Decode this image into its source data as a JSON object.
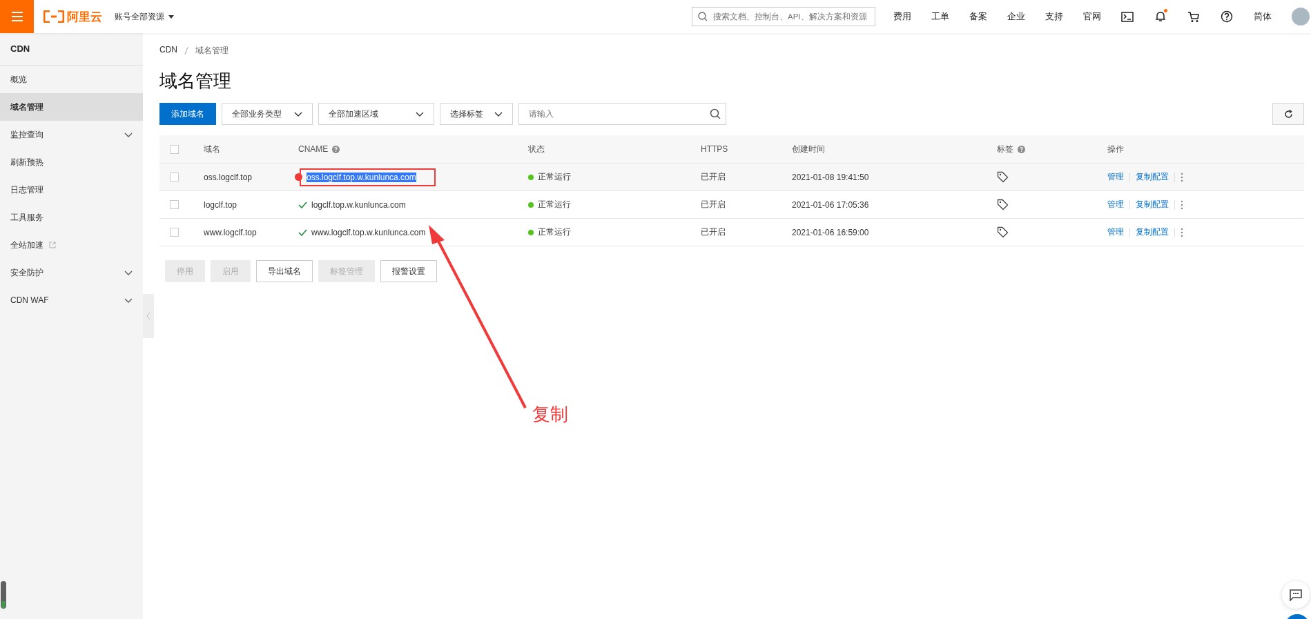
{
  "topbar": {
    "brand": "阿里云",
    "account_menu": "账号全部资源",
    "search": {
      "placeholder": "搜索文档、控制台、API、解决方案和资源"
    },
    "links": [
      "费用",
      "工单",
      "备案",
      "企业",
      "支持",
      "官网"
    ],
    "notification_dot": true,
    "language": "简体"
  },
  "sidebar": {
    "title": "CDN",
    "items": [
      {
        "label": "概览",
        "selected": false,
        "kind": "plain"
      },
      {
        "label": "域名管理",
        "selected": true,
        "kind": "plain"
      },
      {
        "label": "监控查询",
        "selected": false,
        "kind": "expandable"
      },
      {
        "label": "刷新预热",
        "selected": false,
        "kind": "plain"
      },
      {
        "label": "日志管理",
        "selected": false,
        "kind": "plain"
      },
      {
        "label": "工具服务",
        "selected": false,
        "kind": "plain"
      },
      {
        "label": "全站加速",
        "selected": false,
        "kind": "external"
      },
      {
        "label": "安全防护",
        "selected": false,
        "kind": "expandable"
      },
      {
        "label": "CDN WAF",
        "selected": false,
        "kind": "expandable"
      }
    ]
  },
  "breadcrumb": [
    "CDN",
    "域名管理"
  ],
  "page_title": "域名管理",
  "toolbar": {
    "add_button": "添加域名",
    "filters": [
      "全部业务类型",
      "全部加速区域",
      "选择标签"
    ],
    "search": {
      "placeholder": "请输入"
    }
  },
  "table": {
    "select_all_checked": false,
    "columns": [
      {
        "label": "域名",
        "help": false
      },
      {
        "label": "CNAME",
        "help": true
      },
      {
        "label": "状态",
        "help": false
      },
      {
        "label": "HTTPS",
        "help": false
      },
      {
        "label": "创建时间",
        "help": false
      },
      {
        "label": "标签",
        "help": true
      },
      {
        "label": "操作",
        "help": false
      }
    ],
    "rows": [
      {
        "checked": false,
        "hovered": true,
        "domain": "oss.logclf.top",
        "cname": "oss.logclf.top.w.kunlunca.com",
        "cname_ok": false,
        "cname_text_selected": true,
        "annotated": true,
        "status": "正常运行",
        "color": "#52c41a",
        "https": "已开启",
        "created": "2021-01-08 19:41:50",
        "actions": [
          "管理",
          "复制配置"
        ]
      },
      {
        "checked": false,
        "hovered": false,
        "domain": "logclf.top",
        "cname": "logclf.top.w.kunlunca.com",
        "cname_ok": true,
        "cname_text_selected": false,
        "annotated": false,
        "status": "正常运行",
        "color": "#52c41a",
        "https": "已开启",
        "created": "2021-01-06 17:05:36",
        "actions": [
          "管理",
          "复制配置"
        ]
      },
      {
        "checked": false,
        "hovered": false,
        "domain": "www.logclf.top",
        "cname": "www.logclf.top.w.kunlunca.com",
        "cname_ok": true,
        "cname_text_selected": false,
        "annotated": false,
        "status": "正常运行",
        "color": "#52c41a",
        "https": "已开启",
        "created": "2021-01-06 16:59:00",
        "actions": [
          "管理",
          "复制配置"
        ]
      }
    ]
  },
  "bulk_buttons": [
    {
      "label": "停用",
      "disabled": true
    },
    {
      "label": "启用",
      "disabled": true
    },
    {
      "label": "导出域名",
      "disabled": false
    },
    {
      "label": "标签管理",
      "disabled": true
    },
    {
      "label": "报警设置",
      "disabled": false
    }
  ],
  "annotation": {
    "text": "复制"
  }
}
